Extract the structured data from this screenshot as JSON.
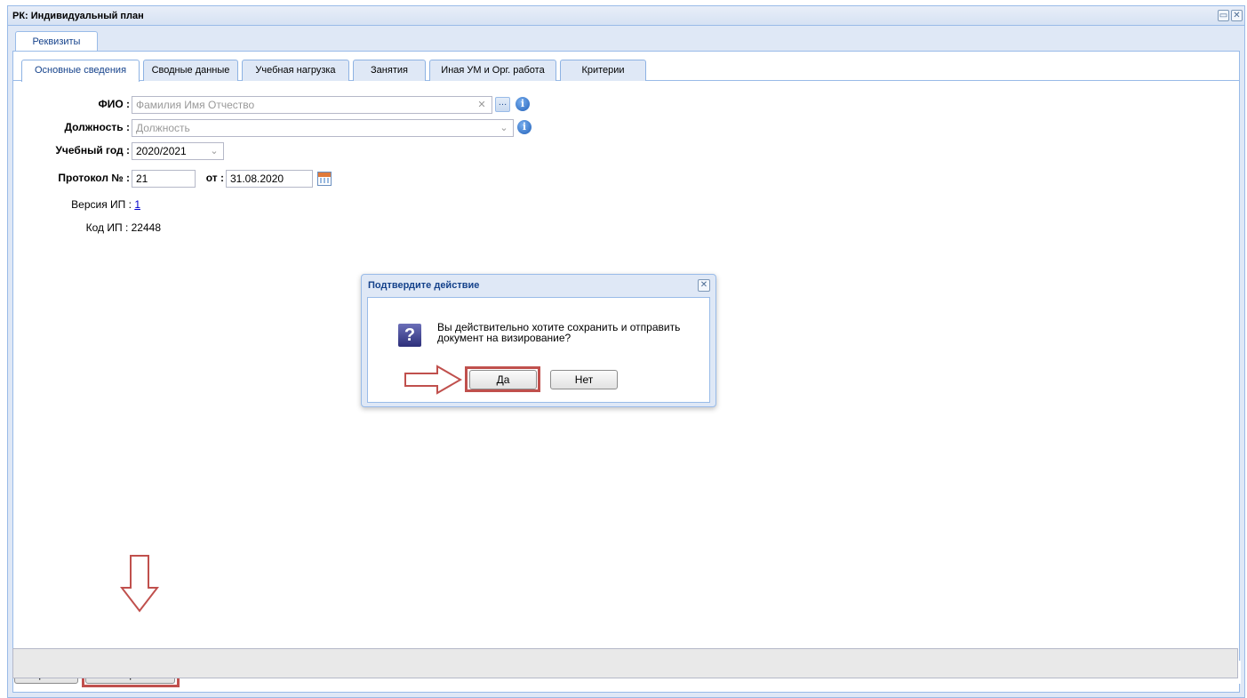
{
  "window": {
    "title": "РК: Индивидуальный план",
    "restore_icon": "restore-icon",
    "close_icon": "close-icon"
  },
  "outer_tabs": [
    {
      "label": "Реквизиты"
    }
  ],
  "inner_tabs": [
    {
      "label": "Основные сведения",
      "active": true
    },
    {
      "label": "Сводные данные"
    },
    {
      "label": "Учебная нагрузка"
    },
    {
      "label": "Занятия"
    },
    {
      "label": "Иная УМ и Орг. работа"
    },
    {
      "label": "Критерии"
    }
  ],
  "form": {
    "fio_label": "ФИО :",
    "fio_placeholder": "Фамилия Имя Отчество",
    "position_label": "Должность :",
    "position_placeholder": "Должность",
    "year_label": "Учебный год :",
    "year_value": "2020/2021",
    "protocol_label": "Протокол № :",
    "protocol_value": "21",
    "from_label": "от :",
    "date_value": "31.08.2020",
    "version_label": "Версия ИП :",
    "version_value": "1",
    "code_label": "Код ИП :",
    "code_value": "22448"
  },
  "toolbar": {
    "save_label": "Сохранить",
    "approve_label": "На визирование"
  },
  "dialog": {
    "title": "Подтвердите действие",
    "message_line1": "Вы действительно хотите сохранить и отправить",
    "message_line2": "документ на визирование?",
    "yes_label": "Да",
    "no_label": "Нет",
    "icon": "question-icon"
  },
  "annotation_color": "#c0504d"
}
